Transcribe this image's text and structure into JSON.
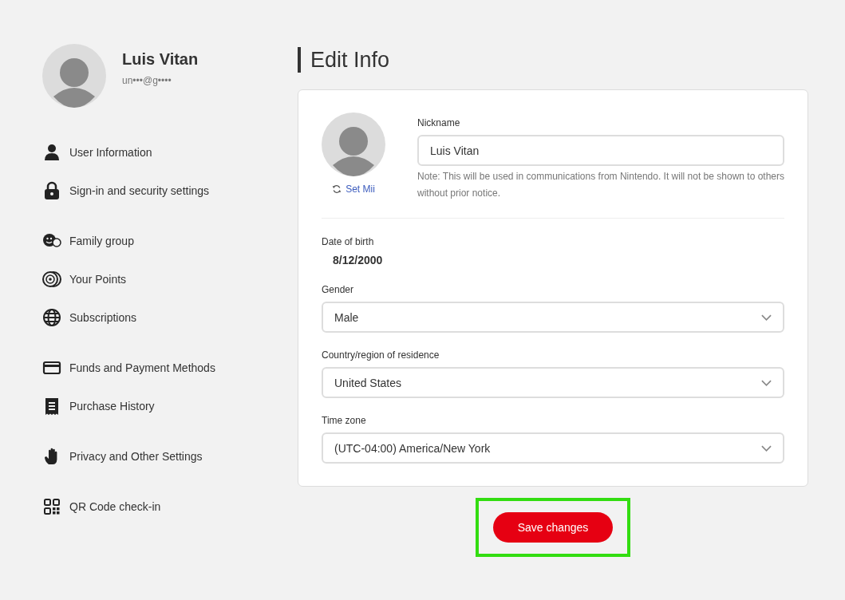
{
  "profile": {
    "name": "Luis Vitan",
    "email": "un•••@g••••"
  },
  "menu_groups": [
    [
      {
        "label": "User Information"
      },
      {
        "label": "Sign-in and security settings"
      }
    ],
    [
      {
        "label": "Family group"
      },
      {
        "label": "Your Points"
      },
      {
        "label": "Subscriptions"
      }
    ],
    [
      {
        "label": "Funds and Payment Methods"
      },
      {
        "label": "Purchase History"
      }
    ],
    [
      {
        "label": "Privacy and Other Settings"
      }
    ],
    [
      {
        "label": "QR Code check-in"
      }
    ]
  ],
  "page_title": "Edit Info",
  "form": {
    "set_mii": "Set Mii",
    "nickname_label": "Nickname",
    "nickname_value": "Luis Vitan",
    "nickname_note": "Note: This will be used in communications from Nintendo. It will not be shown to others without prior notice.",
    "birth_label": "Date of birth",
    "birth_value": "8/12/2000",
    "selects": [
      {
        "label": "Gender",
        "value": "Male"
      },
      {
        "label": "Country/region of residence",
        "value": "United States"
      },
      {
        "label": "Time zone",
        "value": "(UTC-04:00) America/New York"
      }
    ]
  },
  "save_button": {
    "label": "Save changes",
    "highlighted": true
  }
}
